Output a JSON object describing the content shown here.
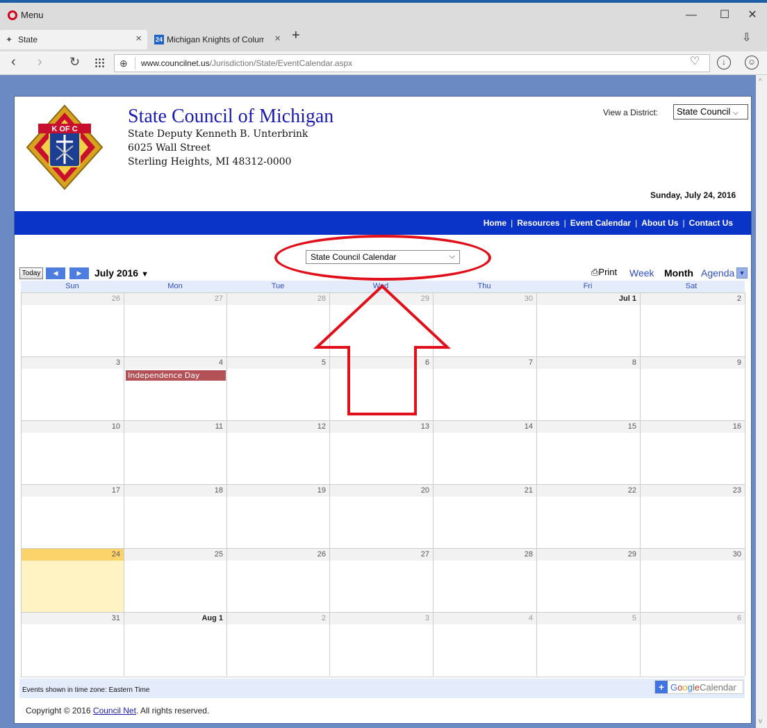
{
  "browser": {
    "menu_label": "Menu",
    "tabs": [
      {
        "title": "State",
        "close": "×"
      },
      {
        "title": "Michigan Knights of Colum",
        "badge": "24",
        "close": "×"
      }
    ],
    "new_tab": "+",
    "url_host": "www.councilnet.us",
    "url_path": "/Jurisdiction/State/EventCalendar.aspx",
    "icons": [
      "opera-icon",
      "back-icon",
      "forward-icon",
      "reload-icon",
      "speed-dial-icon",
      "globe-icon",
      "heart-icon",
      "download-icon",
      "account-icon"
    ]
  },
  "header": {
    "title": "State Council of Michigan",
    "deputy": "State Deputy Kenneth B. Unterbrink",
    "street": "6025 Wall Street",
    "city": "Sterling Heights, MI 48312-0000",
    "district_label": "View a District:",
    "district_value": "State Council",
    "date": "Sunday, July 24, 2016",
    "logo_text": "K OF C"
  },
  "nav": {
    "items": [
      "Home",
      "Resources",
      "Event Calendar",
      "About Us",
      "Contact Us"
    ],
    "separator": "|"
  },
  "calendar": {
    "selector_value": "State Council Calendar",
    "today_label": "Today",
    "month_title": "July 2016",
    "print_label": "Print",
    "views": [
      "Week",
      "Month",
      "Agenda"
    ],
    "active_view": "Month",
    "weekdays": [
      "Sun",
      "Mon",
      "Tue",
      "Wed",
      "Thu",
      "Fri",
      "Sat"
    ],
    "weeks": [
      [
        "26",
        "27",
        "28",
        "29",
        "30",
        "Jul 1",
        "2"
      ],
      [
        "3",
        "4",
        "5",
        "6",
        "7",
        "8",
        "9"
      ],
      [
        "10",
        "11",
        "12",
        "13",
        "14",
        "15",
        "16"
      ],
      [
        "17",
        "18",
        "19",
        "20",
        "21",
        "22",
        "23"
      ],
      [
        "24",
        "25",
        "26",
        "27",
        "28",
        "29",
        "30"
      ],
      [
        "31",
        "Aug 1",
        "2",
        "3",
        "4",
        "5",
        "6"
      ]
    ],
    "today_day": "24",
    "event": {
      "title": "Independence Day",
      "day": "4"
    },
    "timezone_text": "Events shown in time zone: Eastern Time",
    "google_badge": "Google",
    "google_badge_suffix": "Calendar"
  },
  "footer": {
    "prefix": "Copyright © 2016 ",
    "link": "Council Net",
    "suffix": ". All rights reserved."
  },
  "colors": {
    "nav_bar": "#0a34c8",
    "title": "#1a1ab0",
    "today_cell": "#fcd36a",
    "event": "#b45157",
    "annotation": "#e10f1a"
  }
}
